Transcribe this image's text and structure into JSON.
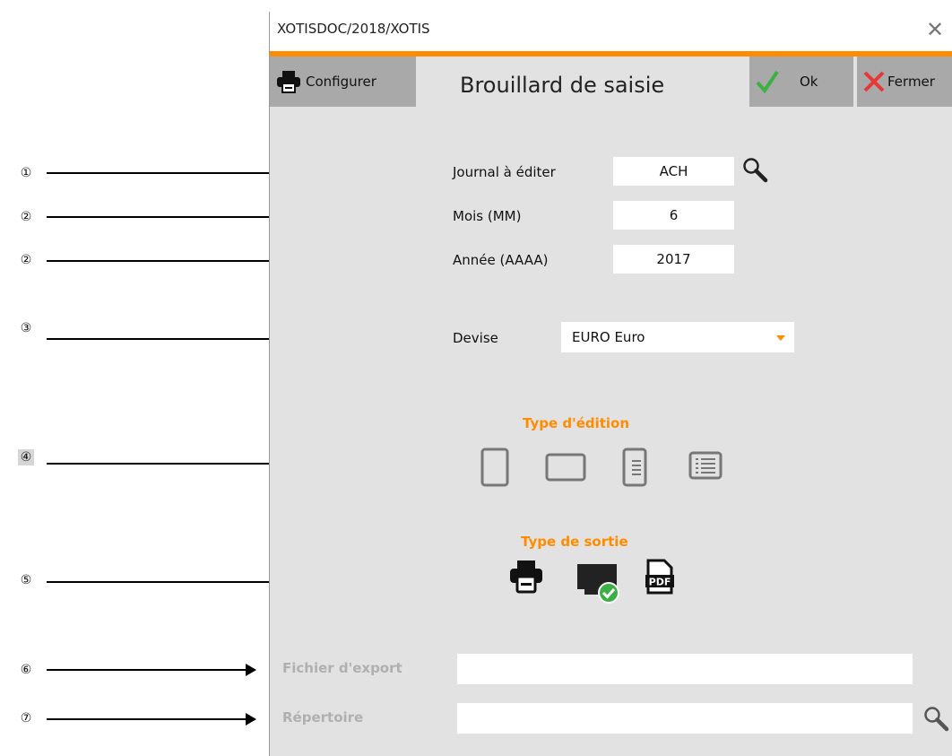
{
  "annotations": {
    "markers": [
      "①",
      "②",
      "②",
      "③",
      "④",
      "⑤",
      "⑥",
      "⑦"
    ]
  },
  "window": {
    "title": "XOTISDOC/2018/XOTIS",
    "close_glyph": "✕"
  },
  "toolbar": {
    "configure_label": "Configurer",
    "ok_label": "Ok",
    "close_label": "Fermer"
  },
  "page_title": "Brouillard de saisie",
  "form": {
    "journal_label": "Journal à éditer",
    "journal_value": "ACH",
    "month_label": "Mois (MM)",
    "month_value": "6",
    "year_label": "Année (AAAA)",
    "year_value": "2017",
    "currency_label": "Devise",
    "currency_value": "EURO Euro"
  },
  "edition_type": {
    "title": "Type d'édition"
  },
  "output_type": {
    "title": "Type de sortie",
    "pdf_text": "PDF"
  },
  "export": {
    "file_label": "Fichier d'export",
    "file_value": "",
    "directory_label": "Répertoire",
    "directory_value": ""
  },
  "colors": {
    "accent": "#ff8c00",
    "window_bg": "#e2e2e2",
    "toolbar_button": "#a9a9a9",
    "ok_check": "#3cb043",
    "close_x": "#e53935"
  }
}
